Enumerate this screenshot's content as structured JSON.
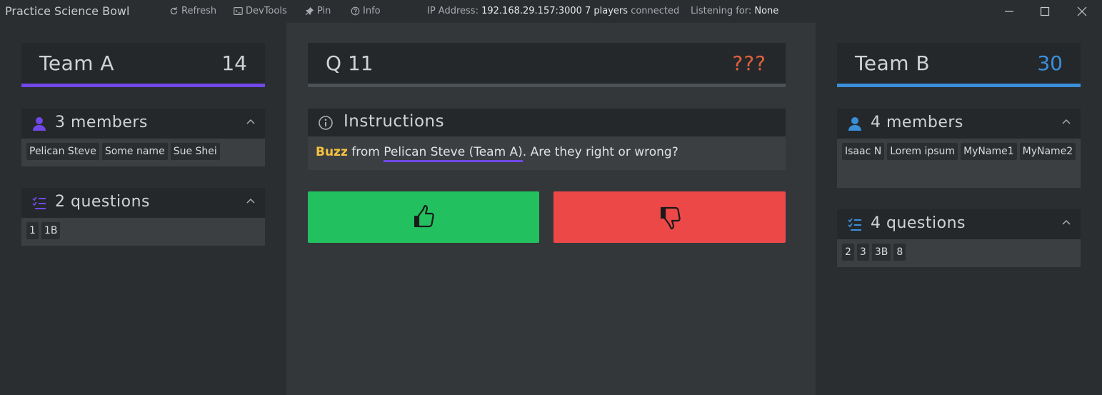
{
  "app": {
    "title": "Practice Science Bowl"
  },
  "toolbar": {
    "refresh_label": "Refresh",
    "devtools_label": "DevTools",
    "pin_label": "Pin",
    "info_label": "Info",
    "ip_label": "IP Address:",
    "ip_value": "192.168.29.157:3000",
    "players_count": "7 players",
    "players_suffix": "connected",
    "listening_label": "Listening for:",
    "listening_value": "None"
  },
  "team_a": {
    "name": "Team A",
    "score": "14",
    "accent": "#7048e8",
    "members_title": "3 members",
    "members": [
      "Pelican Steve",
      "Some name",
      "Sue Shei"
    ],
    "questions_title": "2 questions",
    "questions": [
      "1",
      "1B"
    ]
  },
  "team_b": {
    "name": "Team B",
    "score": "30",
    "accent": "#3b8fd9",
    "members_title": "4 members",
    "members": [
      "Isaac N",
      "Lorem ipsum",
      "MyName1",
      "MyName2"
    ],
    "questions_title": "4 questions",
    "questions": [
      "2",
      "3",
      "3B",
      "8"
    ]
  },
  "question": {
    "number": "Q 11",
    "status": "???"
  },
  "instructions": {
    "title": "Instructions",
    "buzz_word": "Buzz",
    "from_text": " from ",
    "player": "Pelican Steve (Team A)",
    "prompt": ". Are they right or wrong?"
  },
  "judge": {
    "right_color": "#22c05e",
    "wrong_color": "#ec4848",
    "right_icon": "thumbs-up-icon",
    "wrong_icon": "thumbs-down-icon"
  }
}
